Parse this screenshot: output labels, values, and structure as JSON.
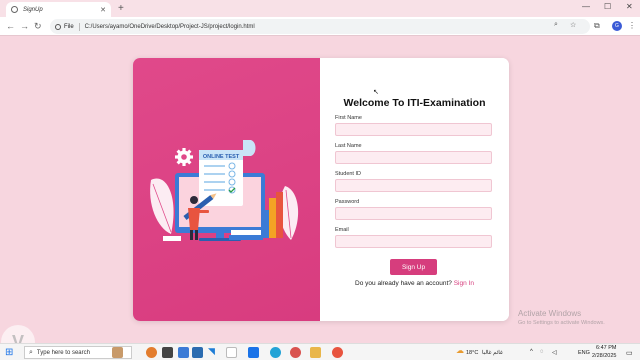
{
  "browser": {
    "tab_title": "SignUp",
    "file_label": "File",
    "url": "C:/Users/ayamo/OneDrive/Desktop/Project-JS/project/login.html",
    "profile_initial": "G"
  },
  "form": {
    "title": "Welcome To ITI-Examination",
    "fields": [
      {
        "label": "First Name"
      },
      {
        "label": "Last Name"
      },
      {
        "label": "Student ID"
      },
      {
        "label": "Password"
      },
      {
        "label": "Email"
      }
    ],
    "submit_label": "Sign Up",
    "prompt": "Do you already have an account?",
    "signin_link": "Sign In"
  },
  "illustration": {
    "screen_text": "ONLINE TEST"
  },
  "watermark": {
    "line1": "Activate Windows",
    "line2": "Go to Settings to activate Windows."
  },
  "taskbar": {
    "search_placeholder": "Type here to search",
    "weather": "18°C",
    "weather_desc": "غائم غالبا",
    "lang": "ENG",
    "time": "6:47 PM",
    "date": "2/28/2025"
  },
  "colors": {
    "accent": "#d63d7d",
    "panel": "#e0498a",
    "page_bg": "#f7d6df",
    "input_bg": "#fdecf1"
  }
}
